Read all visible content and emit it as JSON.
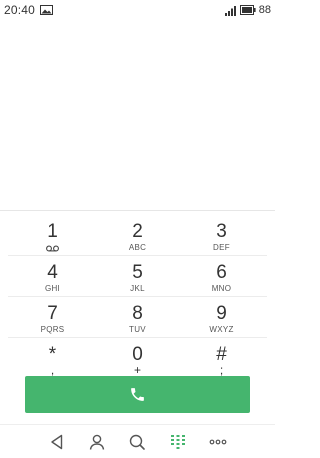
{
  "status_bar": {
    "time": "20:40",
    "battery": "88",
    "icons": [
      "gallery-icon",
      "signal-icon",
      "battery-icon"
    ]
  },
  "keypad": {
    "keys": [
      {
        "digit": "1",
        "letters": ""
      },
      {
        "digit": "2",
        "letters": "ABC"
      },
      {
        "digit": "3",
        "letters": "DEF"
      },
      {
        "digit": "4",
        "letters": "GHI"
      },
      {
        "digit": "5",
        "letters": "JKL"
      },
      {
        "digit": "6",
        "letters": "MNO"
      },
      {
        "digit": "7",
        "letters": "PQRS"
      },
      {
        "digit": "8",
        "letters": "TUV"
      },
      {
        "digit": "9",
        "letters": "WXYZ"
      },
      {
        "digit": "*",
        "letters": ","
      },
      {
        "digit": "0",
        "letters": "+"
      },
      {
        "digit": "#",
        "letters": ";"
      }
    ]
  },
  "call_button": {
    "icon": "phone-icon",
    "color": "#45b56e"
  },
  "nav_bar": {
    "items": [
      "back-icon",
      "contacts-icon",
      "search-icon",
      "dialpad-icon",
      "more-icon"
    ],
    "active_color": "#45b56e"
  }
}
